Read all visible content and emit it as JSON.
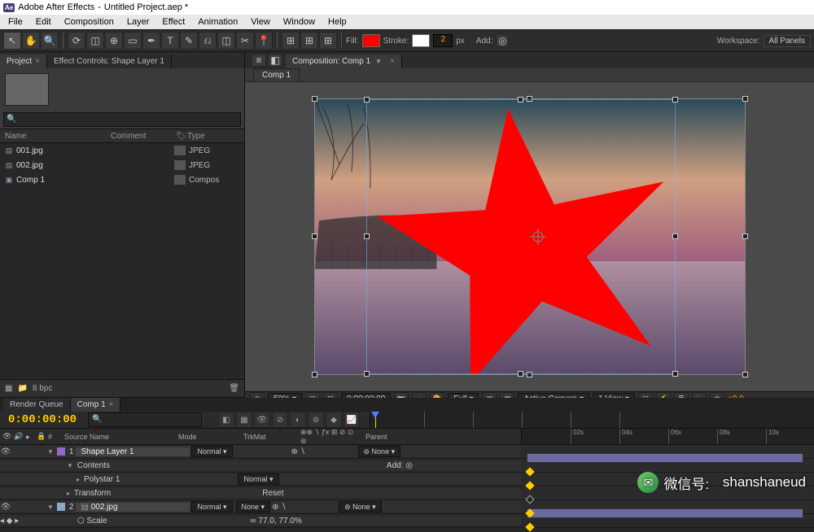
{
  "titlebar": {
    "app": "Adobe After Effects",
    "project": "Untitled Project.aep *"
  },
  "menus": [
    "File",
    "Edit",
    "Composition",
    "Layer",
    "Effect",
    "Animation",
    "View",
    "Window",
    "Help"
  ],
  "toolbar": {
    "fill_label": "Fill:",
    "stroke_label": "Stroke:",
    "stroke_width": "2",
    "stroke_unit": "px",
    "add_label": "Add:",
    "workspace_label": "Workspace:",
    "workspace_value": "All Panels"
  },
  "project_panel": {
    "tab_project": "Project",
    "tab_effect": "Effect Controls: Shape Layer 1",
    "columns": {
      "name": "Name",
      "comment": "Comment",
      "type": "Type"
    },
    "items": [
      {
        "name": "001.jpg",
        "type": "JPEG",
        "icon": "image"
      },
      {
        "name": "002.jpg",
        "type": "JPEG",
        "icon": "image"
      },
      {
        "name": "Comp 1",
        "type": "Compos",
        "icon": "comp"
      }
    ],
    "footer_bpc": "8 bpc"
  },
  "composition_panel": {
    "tab_label": "Composition: Comp 1",
    "subtab": "Comp 1",
    "footer": {
      "zoom": "50%",
      "timecode": "0:00:00:00",
      "resolution": "Full",
      "camera": "Active Camera",
      "views": "1 View",
      "exposure": "+0.0"
    }
  },
  "timeline": {
    "tab_render": "Render Queue",
    "tab_comp": "Comp 1",
    "timecode": "0:00:00:00",
    "header_cols": {
      "source": "Source Name",
      "mode": "Mode",
      "trkmat": "TrkMat",
      "parent": "Parent"
    },
    "ticks": [
      "02s",
      "04s",
      "06s",
      "08s",
      "10s"
    ],
    "layers": [
      {
        "idx": "1",
        "name": "Shape Layer 1",
        "mode": "Normal",
        "trkmat": "",
        "parent": "None",
        "color": "purple",
        "children": [
          {
            "label": "Contents",
            "add": "Add:"
          },
          {
            "label": "Polystar 1",
            "mode": "Normal"
          },
          {
            "label": "Transform",
            "reset": "Reset"
          }
        ]
      },
      {
        "idx": "2",
        "name": "002.jpg",
        "mode": "Normal",
        "trkmat": "None",
        "parent": "None",
        "color": "blue",
        "children": [
          {
            "label": "Scale",
            "value": "77.0, 77.0%",
            "keyframed": true
          }
        ]
      }
    ]
  },
  "watermark": {
    "label": "微信号:",
    "id": "shanshaneud"
  }
}
